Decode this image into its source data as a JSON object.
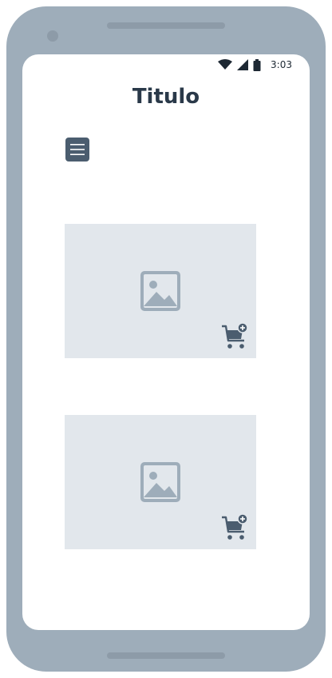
{
  "status_bar": {
    "time": "3:03",
    "wifi_icon": "wifi-icon",
    "signal_icon": "signal-icon",
    "battery_icon": "battery-icon"
  },
  "header": {
    "title": "Titulo"
  },
  "menu": {
    "icon": "hamburger-menu-icon"
  },
  "products": [
    {
      "image_icon": "image-placeholder-icon",
      "action_icon": "add-to-cart-icon"
    },
    {
      "image_icon": "image-placeholder-icon",
      "action_icon": "add-to-cart-icon"
    }
  ],
  "colors": {
    "device_frame": "#9eadba",
    "title": "#2a3949",
    "card_background": "#e2e7ec",
    "placeholder_icon": "#9eadba",
    "cart_icon": "#4b5d6f"
  }
}
